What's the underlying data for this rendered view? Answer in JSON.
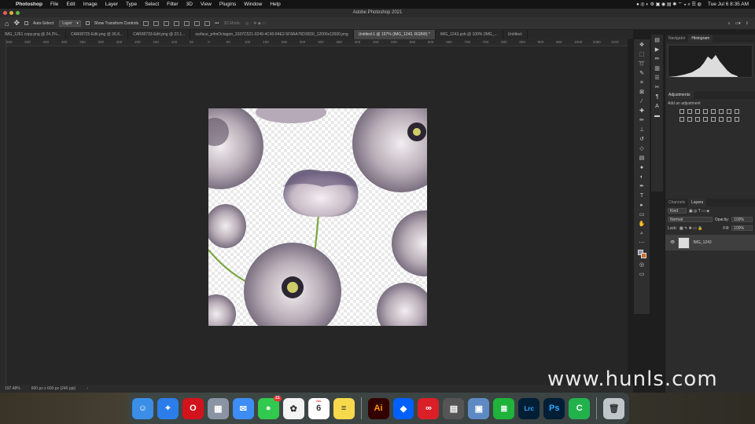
{
  "menubar": {
    "apple": "",
    "app": "Photoshop",
    "items": [
      "File",
      "Edit",
      "Image",
      "Layer",
      "Type",
      "Select",
      "Filter",
      "3D",
      "View",
      "Plugins",
      "Window",
      "Help"
    ],
    "clock": "Tue Jul 6  8:35 AM"
  },
  "window": {
    "title": "Adobe Photoshop 2021"
  },
  "options": {
    "auto_select_label": "Auto-Select:",
    "auto_select_value": "Layer",
    "show_transform_label": "Show Transform Controls",
    "mode_3d": "3D Mode:"
  },
  "tabs": [
    "IMG_1261 copy.png @ 24.2%...",
    "CAR08725-Edit.png @ 36.8...",
    "CAR08733-Edit.png @ 23.1...",
    "surface_p4mOctagon_3337C521-0249-4C40-84E2-5F8AA76D35D0_12000x12000.png",
    "Untitled-1 @ 197% (IMG_1243, RGB/8) *",
    "IMG_1243.psb @ 100% (IMG_...",
    "Untitled-"
  ],
  "ruler_ticks": [
    "550",
    "500",
    "450",
    "400",
    "350",
    "300",
    "250",
    "200",
    "150",
    "100",
    "50",
    "0",
    "50",
    "100",
    "150",
    "200",
    "250",
    "300",
    "350",
    "400",
    "450",
    "500",
    "550",
    "600",
    "650",
    "700",
    "750",
    "800",
    "850",
    "900",
    "950",
    "1000",
    "1050",
    "1100"
  ],
  "status": {
    "zoom": "197.48%",
    "doc": "600 px x 600 px (240 ppi)",
    "arrow": "›"
  },
  "panels": {
    "top_tabs": [
      "Navigator",
      "Histogram"
    ],
    "adjustments_title": "Adjustments",
    "add_adjustment": "Add an adjustment",
    "layer_tabs": [
      "Channels",
      "Layers"
    ],
    "kind": "Kind",
    "blend": "Normal",
    "opacity_label": "Opacity:",
    "opacity_value": "100%",
    "lock_label": "Lock:",
    "fill_label": "Fill:",
    "fill_value": "100%",
    "layer_name": "IMG_1243"
  },
  "dock": {
    "apps": [
      {
        "name": "Finder",
        "color": "#3a8ee6",
        "glyph": "☺"
      },
      {
        "name": "Safari",
        "color": "#2b7de9",
        "glyph": "⌖"
      },
      {
        "name": "Opera",
        "color": "#d3131b",
        "glyph": "O"
      },
      {
        "name": "Launchpad",
        "color": "#8b94a3",
        "glyph": "▦"
      },
      {
        "name": "Mail",
        "color": "#3d8df5",
        "glyph": "✉"
      },
      {
        "name": "Messages",
        "color": "#32c94f",
        "glyph": "●",
        "badge": "21"
      },
      {
        "name": "Photos",
        "color": "#f4f4f4",
        "glyph": "✿"
      },
      {
        "name": "Calendar",
        "color": "#ffffff",
        "glyph": "6",
        "sub": "JUL"
      },
      {
        "name": "Notes",
        "color": "#f7d94c",
        "glyph": "≡"
      },
      {
        "name": "Illustrator",
        "color": "#330000",
        "glyph": "Ai"
      },
      {
        "name": "Dropbox",
        "color": "#0061fe",
        "glyph": "◆"
      },
      {
        "name": "Creative Cloud",
        "color": "#da1f26",
        "glyph": "∞"
      },
      {
        "name": "Calculator",
        "color": "#555555",
        "glyph": "▤"
      },
      {
        "name": "Preview",
        "color": "#5e8ac4",
        "glyph": "▣"
      },
      {
        "name": "Numbers",
        "color": "#1fb33b",
        "glyph": "≣"
      },
      {
        "name": "Lightroom Classic",
        "color": "#001e36",
        "glyph": "Lrc"
      },
      {
        "name": "Photoshop",
        "color": "#001e36",
        "glyph": "Ps"
      },
      {
        "name": "Camo",
        "color": "#22b24c",
        "glyph": "C"
      },
      {
        "name": "Trash",
        "color": "#bfc5c9",
        "glyph": "🗑"
      }
    ]
  },
  "watermark": "www.hunls.com"
}
